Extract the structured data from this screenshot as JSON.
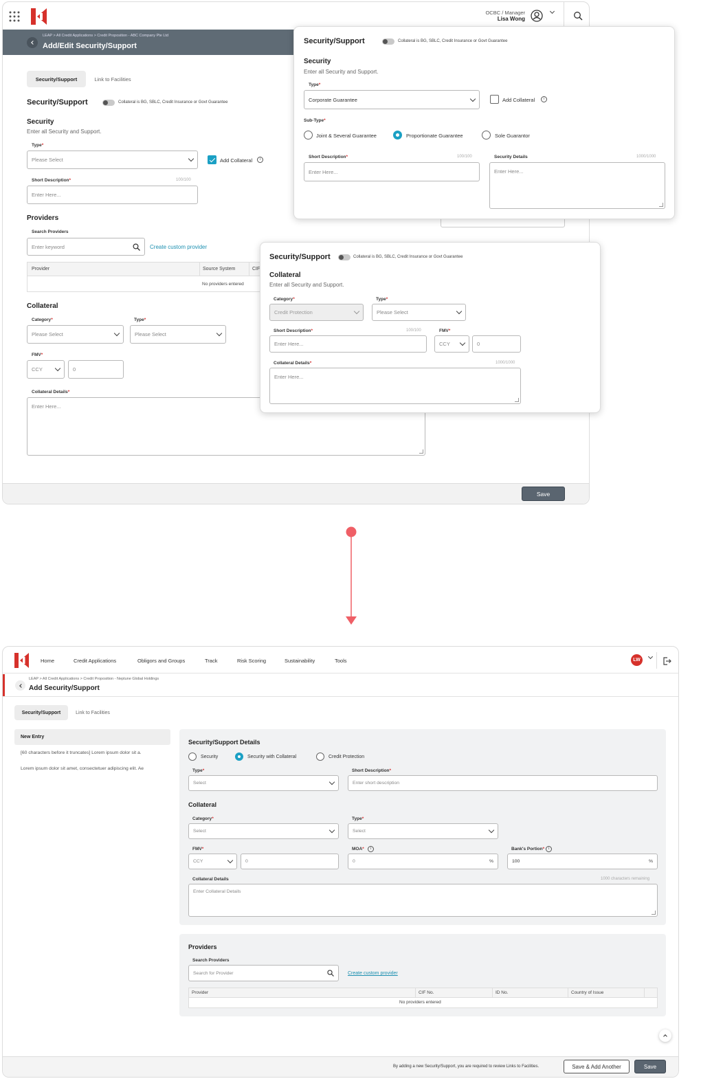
{
  "top": {
    "user_role": "OCBC / Manager",
    "user_name": "Lisa Wong",
    "breadcrumb": "LEAP > All Credit Applications > Credit Proposition - ABC Company Pte Ltd",
    "page_title": "Add/Edit Security/Support",
    "tabs": [
      "Security/Support",
      "Link to Facilities"
    ],
    "section_title": "Security/Support",
    "toggle_label": "Collateral is BG, SBLC, Credit Insurance or Govt Guarantee",
    "security_title": "Security",
    "security_sub": "Enter all Security and Support.",
    "type_label": "Type",
    "type_value": "Please Select",
    "add_collateral": "Add Collateral",
    "short_desc_label": "Short Description",
    "short_desc_counter": "100/100",
    "short_desc_placeholder": "Enter Here...",
    "providers_title": "Providers",
    "search_providers_label": "Search Providers",
    "search_placeholder": "Enter keyword",
    "create_provider": "Create custom provider",
    "table_headers": [
      "Provider",
      "Source System",
      "CIF"
    ],
    "no_providers": "No providers entered",
    "collateral_title": "Collateral",
    "category_label": "Category",
    "category_value": "Please Select",
    "ctype_label": "Type",
    "ctype_value": "Please Select",
    "fmv_label": "FMV",
    "ccy": "CCY",
    "fmv_value": "0",
    "collateral_details_label": "Collateral Details",
    "collateral_details_placeholder": "Enter Here...",
    "save": "Save"
  },
  "popup1": {
    "title": "Security/Support",
    "toggle_label": "Collateral is BG, SBLC, Credit Insurance or Govt Guarantee",
    "security_title": "Security",
    "security_sub": "Enter all Security and Support.",
    "type_label": "Type",
    "type_value": "Corporate Guarantee",
    "add_collateral": "Add Collateral",
    "subtype_label": "Sub-Type",
    "subtypes": [
      "Joint & Several Guarantee",
      "Proportionate Guarantee",
      "Sole Guarantor"
    ],
    "short_desc_label": "Short Description",
    "short_desc_counter": "100/100",
    "short_desc_placeholder": "Enter Here...",
    "details_label": "Security Details",
    "details_counter": "1000/1000",
    "details_placeholder": "Enter Here..."
  },
  "popup2": {
    "title": "Security/Support",
    "toggle_label": "Collateral is BG, SBLC, Credit Insurance or Govt Guarantee",
    "collateral_title": "Collateral",
    "collateral_sub": "Enter all Security and Support.",
    "category_label": "Category",
    "category_value": "Credit Protection",
    "type_label": "Type",
    "type_value": "Please Select",
    "short_desc_label": "Short Description",
    "short_desc_counter": "100/100",
    "short_desc_placeholder": "Enter Here...",
    "fmv_label": "FMV",
    "ccy": "CCY",
    "fmv_value": "0",
    "details_label": "Collateral Details",
    "details_counter": "1000/1000",
    "details_placeholder": "Enter Here..."
  },
  "bottom": {
    "nav": [
      "Home",
      "Credit Applications",
      "Obligors and Groups",
      "Track",
      "Risk Scoring",
      "Sustainability",
      "Tools"
    ],
    "avatar": "LW",
    "breadcrumb": "LEAP > All Credit Applications > Credit Proposition - Neptune Global Holdings",
    "page_title": "Add Security/Support",
    "tabs": [
      "Security/Support",
      "Link to Facilities"
    ],
    "side_title": "New Entry",
    "side_items": [
      "[60 characters before it truncates] Lorem ipsum dolor sit a.",
      "Lorem ipsum dolor sit amet, consectetuer adipiscing elit. Ae"
    ],
    "details_title": "Security/Support Details",
    "radios": [
      "Security",
      "Security with Collateral",
      "Credit Protection"
    ],
    "type_label": "Type",
    "type_value": "Select",
    "short_desc_label": "Short Description",
    "short_desc_placeholder": "Enter short description",
    "collateral_title": "Collateral",
    "category_label": "Category",
    "category_value": "Select",
    "ctype_label": "Type",
    "ctype_value": "Select",
    "fmv_label": "FMV",
    "ccy": "CCY",
    "fmv_value": "0",
    "moa_label": "MOA",
    "moa_value": "0",
    "bank_label": "Bank's Portion",
    "bank_value": "100",
    "percent": "%",
    "coll_details_label": "Collateral Details",
    "coll_details_remaining": "1000 characters remaining",
    "coll_details_placeholder": "Enter Collateral Details",
    "providers_title": "Providers",
    "search_label": "Search Providers",
    "search_placeholder": "Search for Provider",
    "create_provider": "Create custom provider",
    "table_headers": [
      "Provider",
      "CIF No.",
      "ID No.",
      "Country of Issue"
    ],
    "no_providers": "No providers entered",
    "footer_note": "By adding a new Security/Support, you are required to review Links to Facilities.",
    "save_add": "Save & Add Another",
    "save": "Save"
  },
  "colors": {
    "brand": "#d6312b",
    "accent": "#1ba0c4",
    "header_dark": "#5f6b75"
  }
}
